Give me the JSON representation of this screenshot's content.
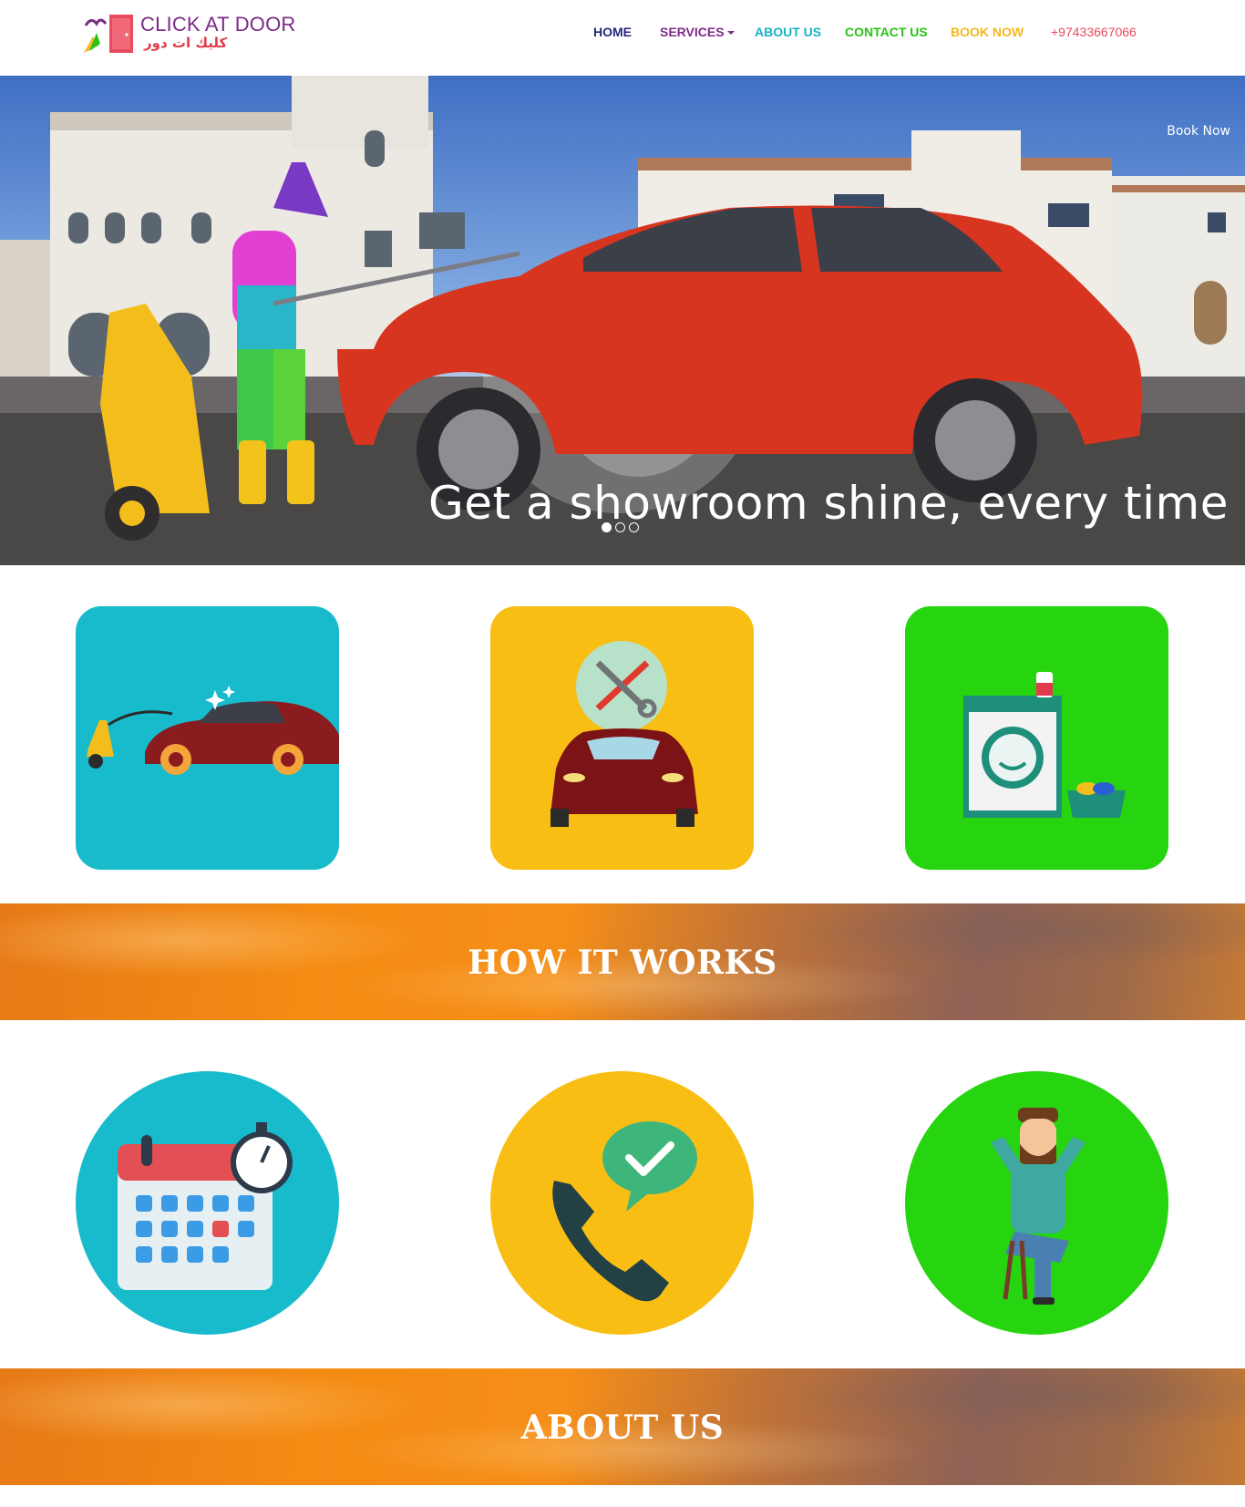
{
  "brand": {
    "name_en": "CLICK AT DOOR",
    "name_ar": "كليك ات دور"
  },
  "nav": {
    "home": "HOME",
    "services": "SERVICES",
    "about": "ABOUT US",
    "contact": "CONTACT US",
    "book": "BOOK NOW",
    "phone": "+97433667066"
  },
  "hero": {
    "caption": "Get a showroom shine, every time",
    "book_link": "Book Now",
    "slides_count": 3,
    "active_slide": 1
  },
  "services": [
    {
      "icon": "car-wash-icon",
      "color": "#17bbcc"
    },
    {
      "icon": "car-repair-icon",
      "color": "#f9be13"
    },
    {
      "icon": "laundry-icon",
      "color": "#26d40f"
    }
  ],
  "how_it_works": {
    "title": "HOW IT WORKS",
    "steps": [
      {
        "icon": "calendar-clock-icon",
        "color": "#17bbcc"
      },
      {
        "icon": "phone-confirm-icon",
        "color": "#f9be13"
      },
      {
        "icon": "relaxed-man-icon",
        "color": "#26d40f"
      }
    ]
  },
  "about": {
    "title": "ABOUT US"
  }
}
